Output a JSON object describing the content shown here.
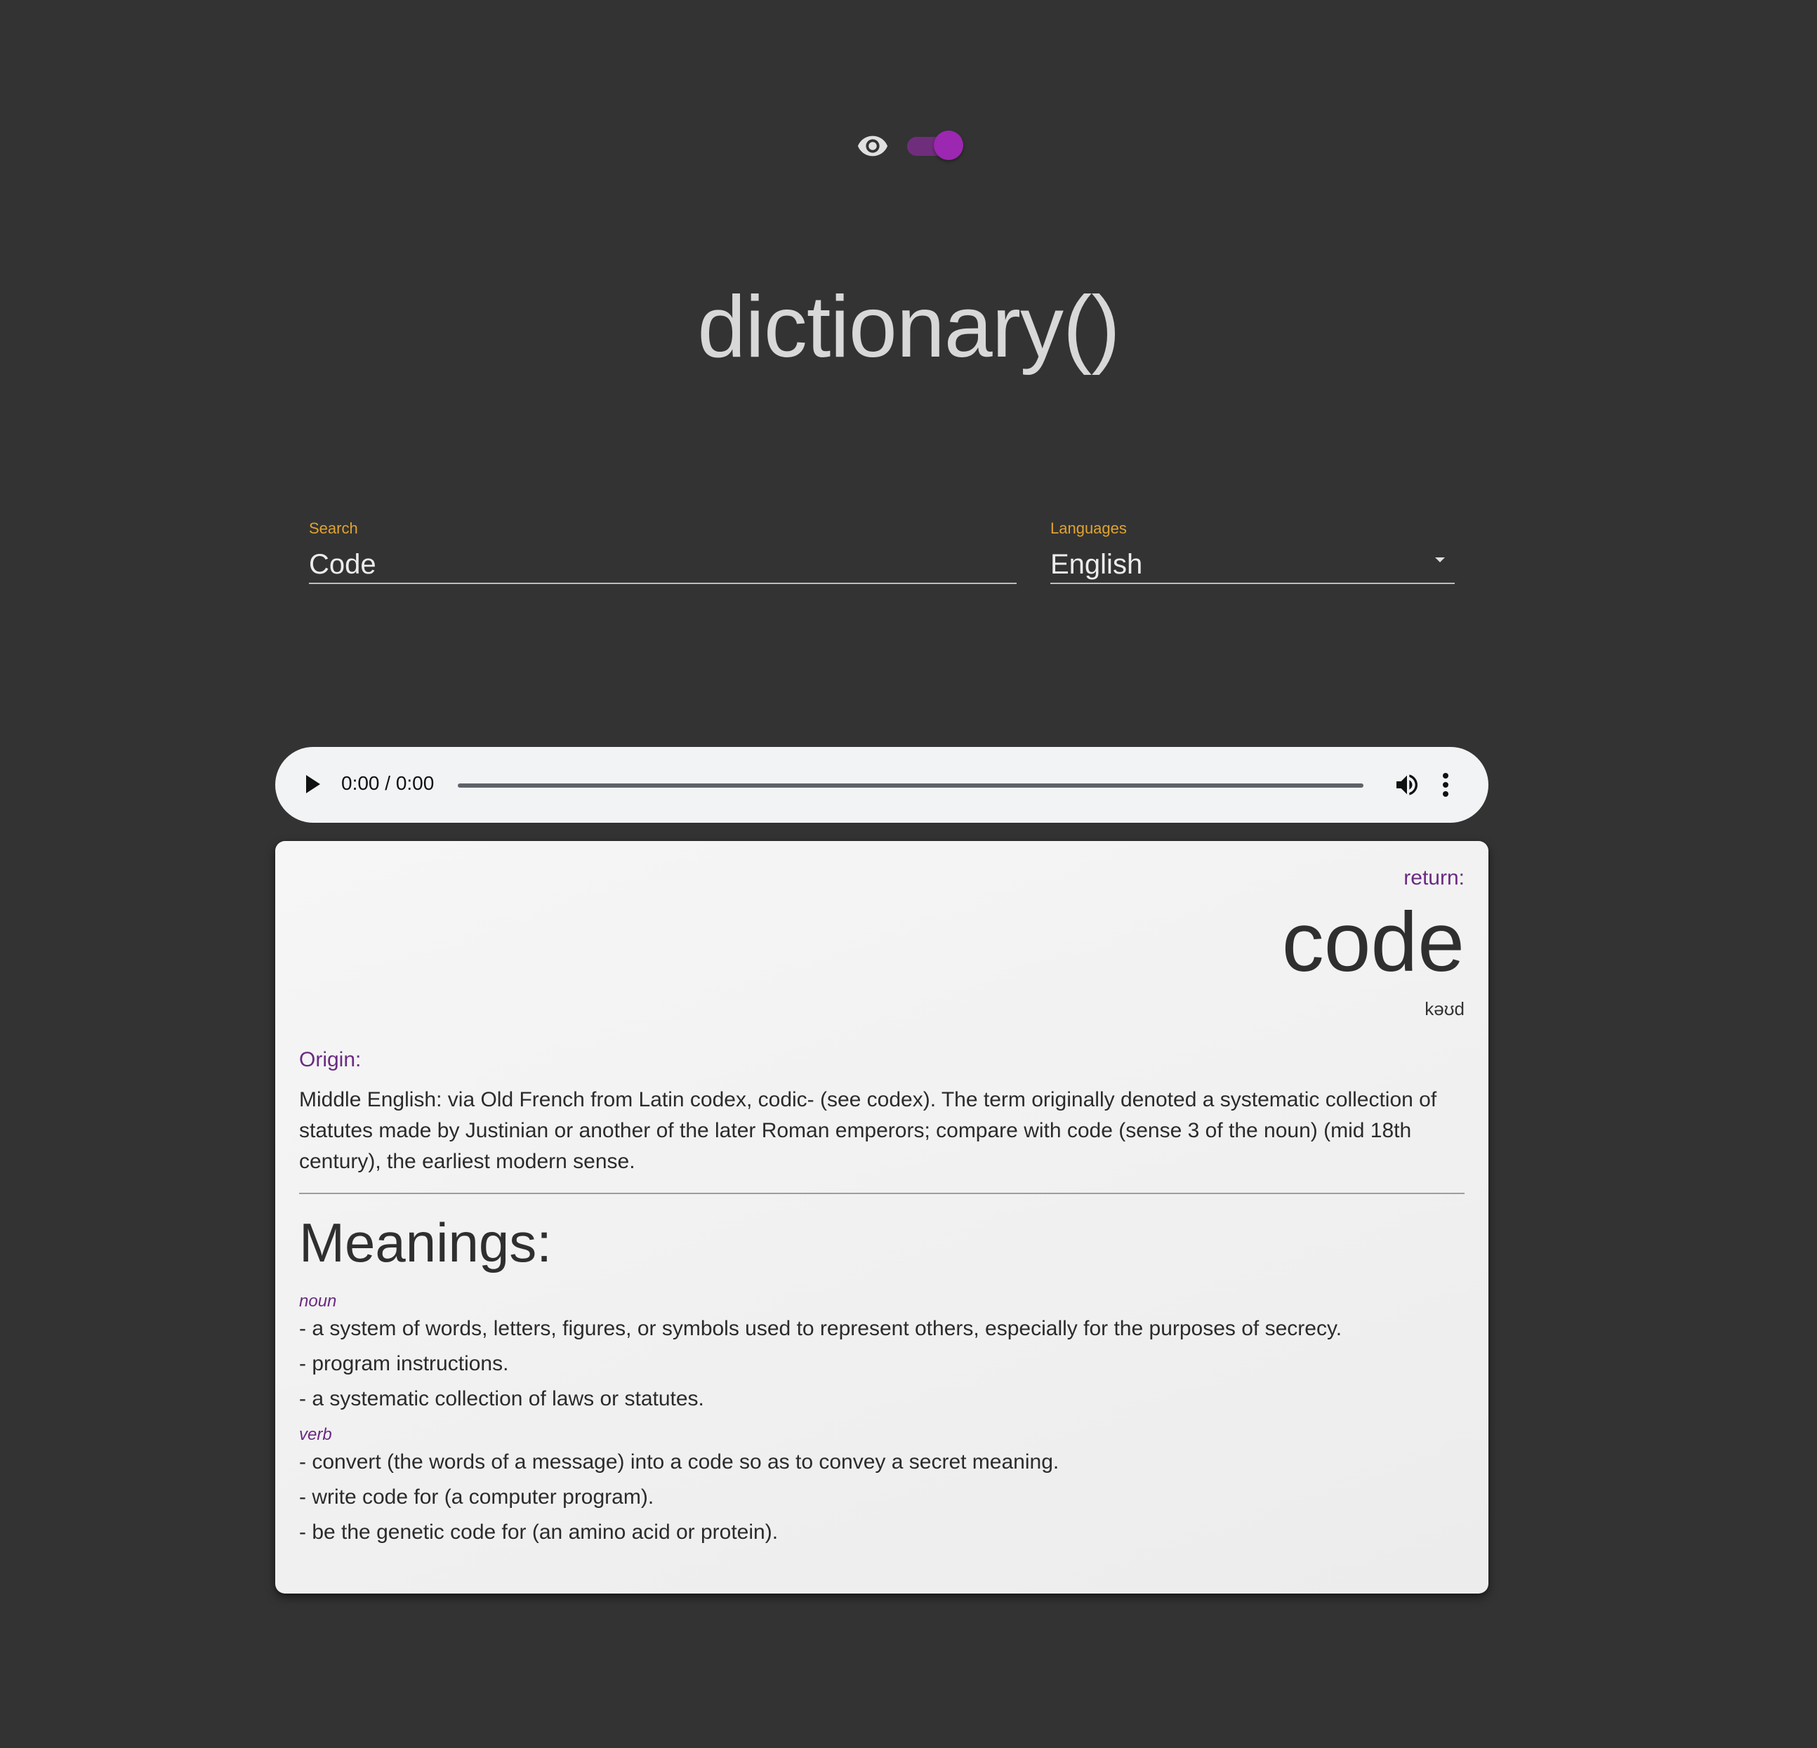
{
  "theme_toggle": {
    "enabled": true,
    "icon": "eye-icon",
    "accent_color": "#9c27b0"
  },
  "app": {
    "title": "dictionary()"
  },
  "search": {
    "label": "Search",
    "value": "Code"
  },
  "languages": {
    "label": "Languages",
    "value": "English"
  },
  "audio": {
    "time": "0:00 / 0:00"
  },
  "result": {
    "return_label": "return:",
    "word": "code",
    "phonetic": "kəʊd",
    "origin_label": "Origin:",
    "origin_text": "Middle English: via Old French from Latin codex, codic- (see codex). The term originally denoted a systematic collection of statutes made by Justinian or another of the later Roman emperors; compare with code (sense 3 of the noun) (mid 18th century), the earliest modern sense.",
    "meanings_title": "Meanings:",
    "meanings": [
      {
        "part_of_speech": "noun",
        "definitions": [
          "- a system of words, letters, figures, or symbols used to represent others, especially for the purposes of secrecy.",
          "- program instructions.",
          "- a systematic collection of laws or statutes."
        ]
      },
      {
        "part_of_speech": "verb",
        "definitions": [
          "- convert (the words of a message) into a code so as to convey a secret meaning.",
          "- write code for (a computer program).",
          "- be the genetic code for (an amino acid or protein)."
        ]
      }
    ]
  },
  "colors": {
    "background": "#333333",
    "label_accent": "#e0a32f",
    "purple_accent": "#6a2a82"
  }
}
